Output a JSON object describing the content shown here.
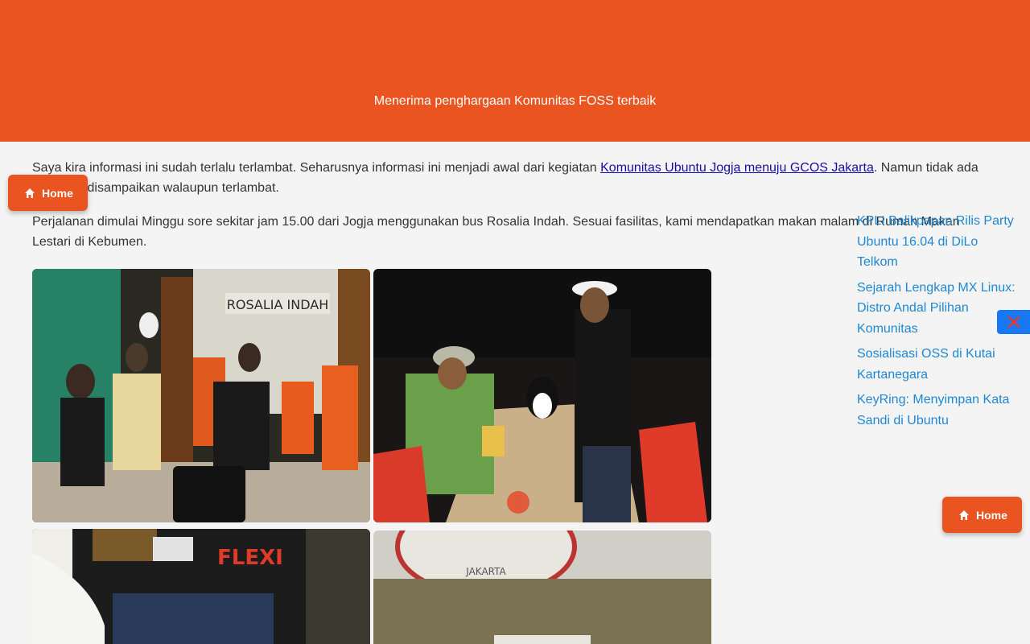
{
  "header": {
    "subtitle": "Menerima penghargaan Komunitas FOSS terbaik"
  },
  "article": {
    "p1_before": "Saya kira informasi ini sudah terlalu terlambat. Seharusnya informasi ini menjadi awal dari kegiatan ",
    "p1_link": "Komunitas Ubuntu Jogja menuju GCOS Jakarta",
    "p1_after": ". Namun tidak ada salahnya disampaikan walaupun terlambat.",
    "p2": "Perjalanan dimulai Minggu sore sekitar jam 15.00 dari Jogja menggunakan bus Rosalia Indah. Sesuai fasilitas, kami mendapatkan makan malam di Rumah Makan Lestari di Kebumen.",
    "photos": [
      {
        "label": "ROSALIA INDAH"
      },
      {
        "label": ""
      },
      {
        "label": "FLEXI"
      },
      {
        "label": "JAKARTA"
      }
    ]
  },
  "sidebar": {
    "links": [
      "KPLI Balikpapan Rilis Party Ubuntu 16.04 di DiLo Telkom",
      "Sejarah Lengkap MX Linux: Distro Andal Pilihan Komunitas",
      "Sosialisasi OSS di Kutai Kartanegara",
      "KeyRing: Menyimpan Kata Sandi di Ubuntu"
    ]
  },
  "buttons": {
    "home_label": "Home",
    "home_icon": "home-icon",
    "close_icon": "close-icon"
  },
  "colors": {
    "brand": "#e95420",
    "link": "#1e88d5",
    "close": "#1877f2"
  }
}
